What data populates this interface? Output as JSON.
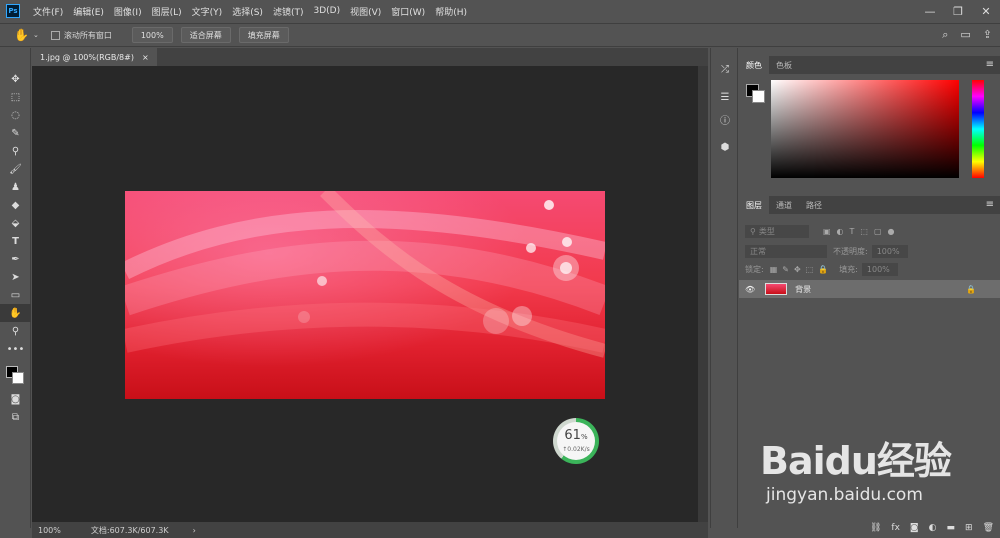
{
  "menubar": {
    "logo": "Ps",
    "items": [
      "文件(F)",
      "编辑(E)",
      "图像(I)",
      "图层(L)",
      "文字(Y)",
      "选择(S)",
      "滤镜(T)",
      "3D(D)",
      "视图(V)",
      "窗口(W)",
      "帮助(H)"
    ]
  },
  "optbar": {
    "scroll_all": "滚动所有窗口",
    "zoom": "100%",
    "fit_screen": "适合屏幕",
    "fill_screen": "填充屏幕"
  },
  "document": {
    "tab_title": "1.jpg @ 100%(RGB/8#)",
    "tab_close": "×",
    "status_zoom": "100%",
    "status_doc": "文档:607.3K/607.3K",
    "status_arrow": "›"
  },
  "net_widget": {
    "percent": "61",
    "unit": "%",
    "speed": "↑0.02K/s",
    "progress": 0.61
  },
  "color_panel": {
    "tabs": [
      "颜色",
      "色板"
    ]
  },
  "layers_panel": {
    "tabs": [
      "图层",
      "通道",
      "路径"
    ],
    "filter_kind": "类型",
    "blend_mode": "正常",
    "opacity_label": "不透明度:",
    "opacity_value": "100%",
    "lock_label": "锁定:",
    "fill_label": "填充:",
    "fill_value": "100%",
    "layer_name": "背景"
  },
  "watermark": {
    "main": "Baidu经验",
    "sub": "jingyan.baidu.com"
  },
  "colors": {
    "accent_green": "#3bb45a",
    "panel_bg": "#535353",
    "canvas_bg": "#282828"
  }
}
